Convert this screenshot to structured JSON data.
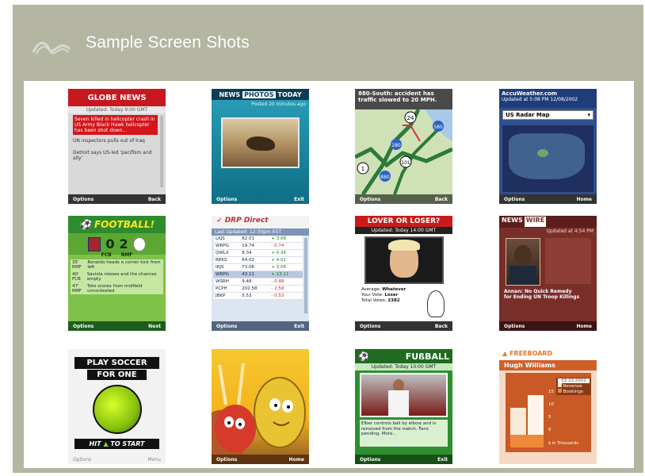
{
  "page": {
    "title": "Sample Screen Shots",
    "logo_icon": "mountain-outline-icon"
  },
  "shots": [
    {
      "id": "globe-news",
      "brand": "GLOBE NEWS",
      "updated": "Updated: Today 9:00 GMT",
      "items": [
        "Seven killed in helicopter crash in US Army Black Hawk helicopter has been shot down...",
        "UN inspectors pulls out of Iraq",
        "Detroit says US-led 'pacifism and ally'"
      ],
      "left_key": "Options",
      "right_key": "Back"
    },
    {
      "id": "news-photos-today",
      "brand_a": "NEWS",
      "brand_b": "PHOTOS",
      "brand_c": "TODAY",
      "subtitle": "Posted 20 minutes ago",
      "left_key": "Options",
      "right_key": "Exit"
    },
    {
      "id": "traffic-map",
      "headline": "880-South: accident has traffic slowed to 20 MPH.",
      "road_labels": [
        "24",
        "280",
        "580",
        "101",
        "880",
        "1"
      ],
      "left_key": "Options",
      "right_key": "Back"
    },
    {
      "id": "accuweather",
      "brand": "AccuWeather.com",
      "updated": "Updated at 5:08 PM 12/08/2002",
      "select_value": "US Radar Map",
      "left_key": "Options",
      "right_key": "Home"
    },
    {
      "id": "football",
      "brand": "FOOTBALL!",
      "score_home": "0",
      "score_away": "2",
      "team_home": "FCB",
      "team_away": "RMF",
      "events": [
        {
          "min": "35'",
          "team": "RMF",
          "text": "Ronaldo heads a corner kick from left"
        },
        {
          "min": "40'",
          "team": "FCB",
          "text": "Saviola misses and the chances empty"
        },
        {
          "min": "47'",
          "team": "RMF",
          "text": "Toto scores from midfield uncontested"
        }
      ],
      "left_key": "Options",
      "right_key": "Next"
    },
    {
      "id": "drp-direct",
      "brand": "DRP Direct",
      "updated": "Last Updated: 12:30pm EST",
      "rows": [
        [
          "LKJS",
          "82.01",
          "+ 3.08"
        ],
        [
          "WRPG",
          "19.74",
          "- 0.74"
        ],
        [
          "QWLX",
          "8.34",
          "+ 0.34"
        ],
        [
          "REKS",
          "64.02",
          "+ 4.02"
        ],
        [
          "IRJS",
          "73.06",
          "+ 3.06"
        ],
        [
          "WRPG",
          "43.11",
          "+ 13.11"
        ],
        [
          "WSRH",
          "9.48",
          "- 0.48"
        ],
        [
          "PCPH",
          "202.58",
          "- 2.58"
        ],
        [
          "JBKP",
          "5.53",
          "- 0.53"
        ]
      ],
      "left_key": "Options",
      "right_key": "Exit"
    },
    {
      "id": "lover-or-loser",
      "brand": "LOVER OR LOSER?",
      "updated": "Updated: Today 14:00 GMT",
      "average_label": "Average:",
      "average_value": "Whatever",
      "your_vote_label": "Your Vote:",
      "your_vote_value": "Loser",
      "total_votes_label": "Total Votes:",
      "total_votes_value": "2382",
      "left_key": "Options",
      "right_key": "Back"
    },
    {
      "id": "news-wire",
      "brand_a": "NEWS",
      "brand_b": "WIRE",
      "updated": "Updated at 4:54 PM",
      "caption": "Annan: No Quick Remedy for Ending UN Troop Killings",
      "left_key": "Options",
      "right_key": "Home"
    },
    {
      "id": "play-soccer",
      "line1": "PLAY SOCCER",
      "line2": "FOR ONE",
      "hit": "HIT",
      "to_start": "TO START",
      "left_key": "Options",
      "right_key": "Menu"
    },
    {
      "id": "cartoon",
      "left_key": "Options",
      "right_key": "Home"
    },
    {
      "id": "fussball",
      "brand": "FUßBALL",
      "updated": "Updated: Today 10:00 GMT",
      "caption": "Elber controls ball by elbow and is removed from the match. Fans pending. More...",
      "left_key": "Options",
      "right_key": "Exit"
    },
    {
      "id": "freeboard",
      "brand": "FREEBOARD",
      "name": "Hugh Williams",
      "date": "03.23.2002",
      "legend_a": "Revenue",
      "legend_b": "Bookings",
      "axis_values": [
        "15",
        "10",
        "5",
        "0"
      ],
      "axis_unit": "$ in Thousands"
    }
  ]
}
